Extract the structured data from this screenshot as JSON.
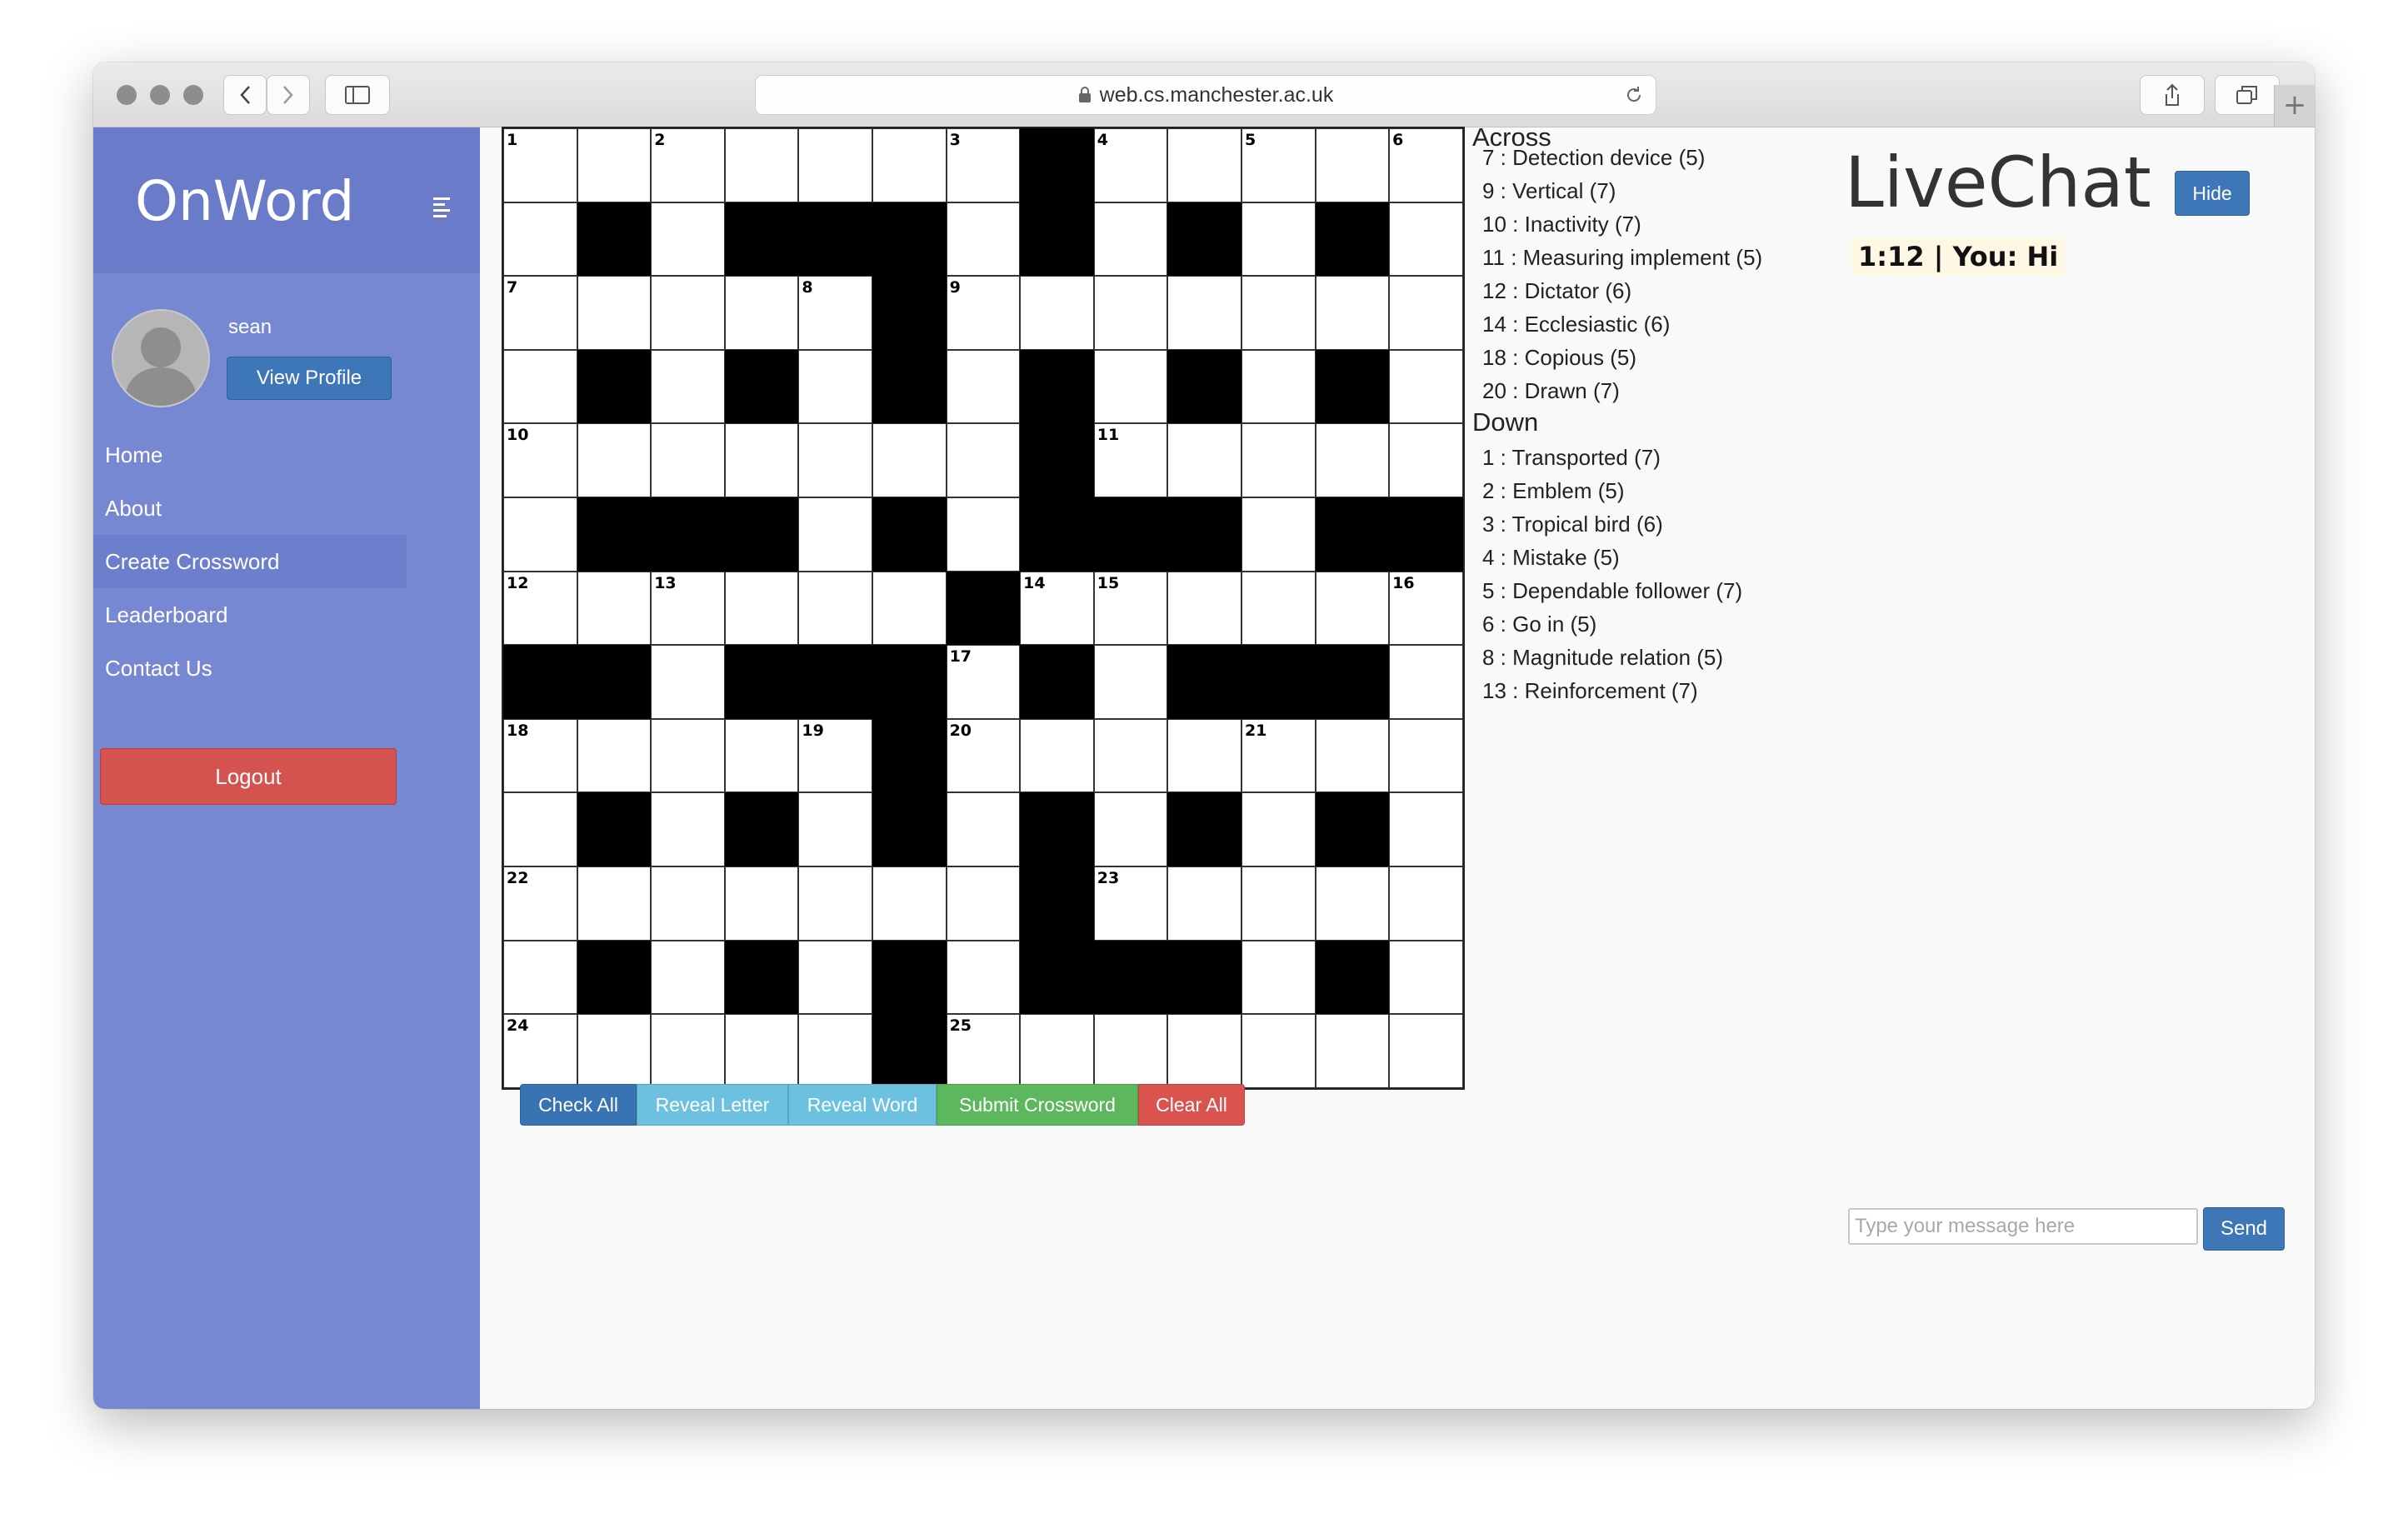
{
  "browser": {
    "url": "web.cs.manchester.ac.uk"
  },
  "sidebar": {
    "brand": "OnWord",
    "username": "sean",
    "view_profile": "View Profile",
    "nav": [
      "Home",
      "About",
      "Create Crossword",
      "Leaderboard",
      "Contact Us"
    ],
    "active_nav": "Create Crossword",
    "logout": "Logout"
  },
  "crossword": {
    "size": 13,
    "rows": [
      "1.2...3#4.5.6",
      ".#.###.#.#.#.",
      "7...8#9......",
      ".#.#.#.#.#.#.",
      "10.....#11....",
      ".###.#.###.##",
      "12.13...#1415...16",
      "##.###17#.####.",
      "18...19#20...21..",
      ".#.#.#.#.#.#.",
      "22.......#23.....",
      ".#.#.#.###.#.",
      "24....#25......."
    ],
    "black": [
      [
        0,
        7
      ],
      [
        1,
        1
      ],
      [
        1,
        3
      ],
      [
        1,
        4
      ],
      [
        1,
        5
      ],
      [
        1,
        7
      ],
      [
        1,
        9
      ],
      [
        1,
        11
      ],
      [
        2,
        5
      ],
      [
        3,
        1
      ],
      [
        3,
        3
      ],
      [
        3,
        5
      ],
      [
        3,
        7
      ],
      [
        3,
        9
      ],
      [
        3,
        11
      ],
      [
        4,
        7
      ],
      [
        5,
        1
      ],
      [
        5,
        2
      ],
      [
        5,
        3
      ],
      [
        5,
        5
      ],
      [
        5,
        7
      ],
      [
        5,
        8
      ],
      [
        5,
        9
      ],
      [
        5,
        11
      ],
      [
        5,
        12
      ],
      [
        6,
        6
      ],
      [
        7,
        0
      ],
      [
        7,
        1
      ],
      [
        7,
        3
      ],
      [
        7,
        4
      ],
      [
        7,
        5
      ],
      [
        7,
        7
      ],
      [
        7,
        9
      ],
      [
        7,
        10
      ],
      [
        7,
        11
      ],
      [
        8,
        5
      ],
      [
        9,
        1
      ],
      [
        9,
        3
      ],
      [
        9,
        5
      ],
      [
        9,
        7
      ],
      [
        9,
        9
      ],
      [
        9,
        11
      ],
      [
        10,
        7
      ],
      [
        11,
        1
      ],
      [
        11,
        3
      ],
      [
        11,
        5
      ],
      [
        11,
        7
      ],
      [
        11,
        8
      ],
      [
        11,
        9
      ],
      [
        11,
        11
      ],
      [
        12,
        5
      ]
    ],
    "numbers": [
      {
        "r": 0,
        "c": 0,
        "n": "1"
      },
      {
        "r": 0,
        "c": 2,
        "n": "2"
      },
      {
        "r": 0,
        "c": 6,
        "n": "3"
      },
      {
        "r": 0,
        "c": 8,
        "n": "4"
      },
      {
        "r": 0,
        "c": 10,
        "n": "5"
      },
      {
        "r": 0,
        "c": 12,
        "n": "6"
      },
      {
        "r": 2,
        "c": 0,
        "n": "7"
      },
      {
        "r": 2,
        "c": 4,
        "n": "8"
      },
      {
        "r": 2,
        "c": 6,
        "n": "9"
      },
      {
        "r": 4,
        "c": 0,
        "n": "10"
      },
      {
        "r": 4,
        "c": 8,
        "n": "11"
      },
      {
        "r": 6,
        "c": 0,
        "n": "12"
      },
      {
        "r": 6,
        "c": 2,
        "n": "13"
      },
      {
        "r": 6,
        "c": 7,
        "n": "14"
      },
      {
        "r": 6,
        "c": 8,
        "n": "15"
      },
      {
        "r": 6,
        "c": 12,
        "n": "16"
      },
      {
        "r": 7,
        "c": 6,
        "n": "17"
      },
      {
        "r": 8,
        "c": 0,
        "n": "18"
      },
      {
        "r": 8,
        "c": 4,
        "n": "19"
      },
      {
        "r": 8,
        "c": 6,
        "n": "20"
      },
      {
        "r": 8,
        "c": 10,
        "n": "21"
      },
      {
        "r": 10,
        "c": 0,
        "n": "22"
      },
      {
        "r": 10,
        "c": 8,
        "n": "23"
      },
      {
        "r": 12,
        "c": 0,
        "n": "24"
      },
      {
        "r": 12,
        "c": 6,
        "n": "25"
      }
    ]
  },
  "clues": {
    "across_title": "Across",
    "across": [
      "7 : Detection device (5)",
      "9 : Vertical (7)",
      "10 : Inactivity (7)",
      "11 : Measuring implement (5)",
      "12 : Dictator (6)",
      "14 : Ecclesiastic (6)",
      "18 : Copious (5)",
      "20 : Drawn (7)"
    ],
    "down_title": "Down",
    "down": [
      "1 : Transported (7)",
      "2 : Emblem (5)",
      "3 : Tropical bird (6)",
      "4 : Mistake (5)",
      "5 : Dependable follower (7)",
      "6 : Go in (5)",
      "8 : Magnitude relation (5)",
      "13 : Reinforcement (7)"
    ]
  },
  "actions": {
    "check_all": "Check All",
    "reveal_letter": "Reveal Letter",
    "reveal_word": "Reveal Word",
    "submit": "Submit Crossword",
    "clear_all": "Clear All"
  },
  "chat": {
    "title": "LiveChat",
    "hide": "Hide",
    "messages": [
      "1:12 | You: Hi"
    ],
    "input_placeholder": "Type your message here",
    "send": "Send"
  },
  "colors": {
    "sidebar": "#7788d3",
    "primary": "#3a74b4",
    "info": "#6cc0df",
    "success": "#5cb85c",
    "danger": "#d9534f"
  }
}
